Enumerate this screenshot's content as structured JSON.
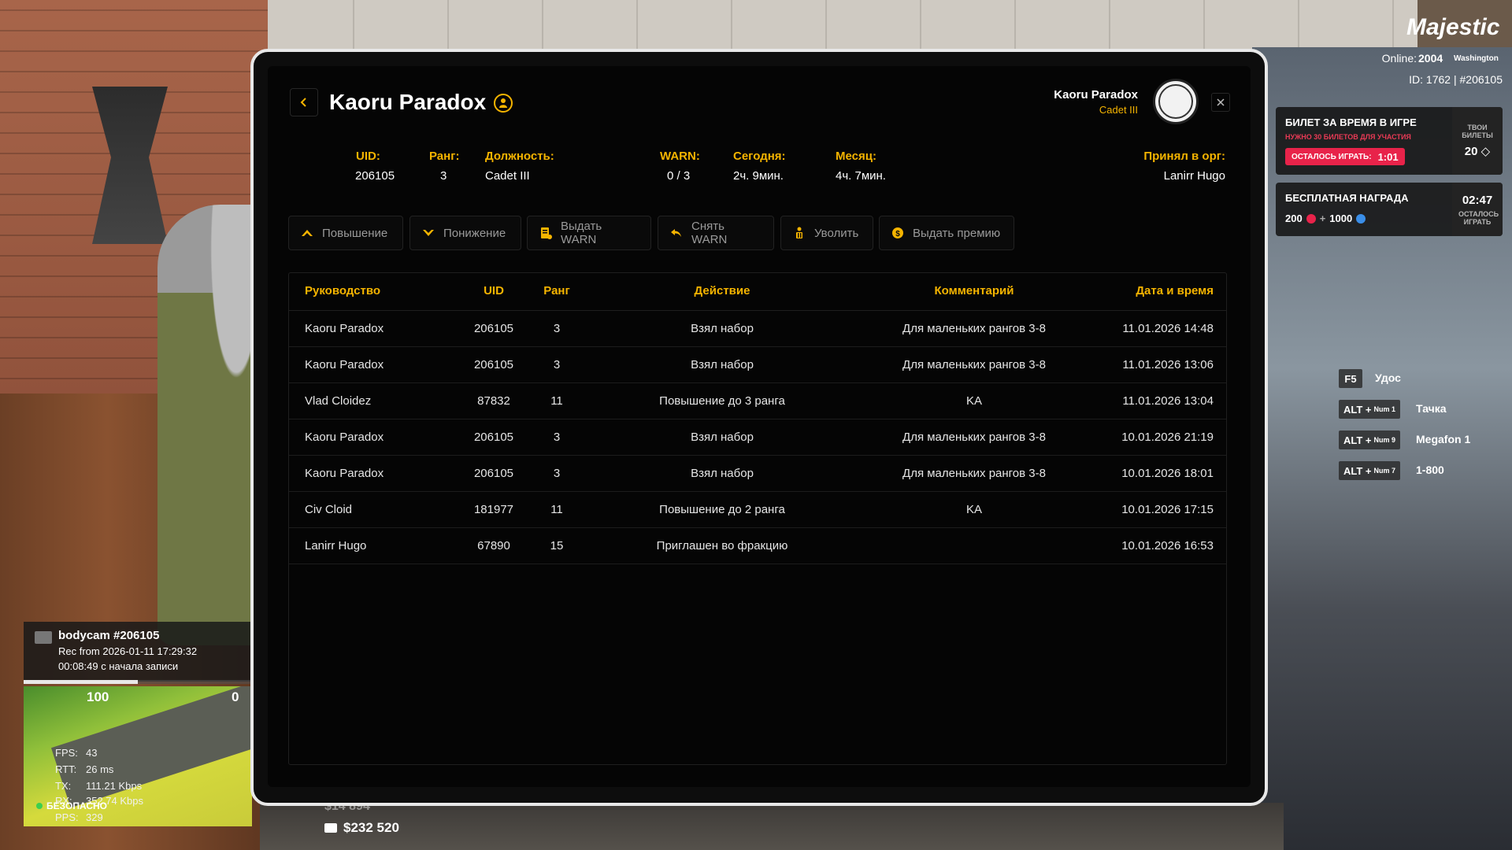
{
  "hud": {
    "brand": "Majestic",
    "online_label": "Online:",
    "online_value": "2004",
    "server": "Washington",
    "ids": "ID: 1762 | #206105"
  },
  "cards": {
    "ticket": {
      "title": "БИЛЕТ ЗА ВРЕМЯ В ИГРЕ",
      "subtitle": "НУЖНО 30 БИЛЕТОВ ДЛЯ УЧАСТИЯ",
      "pill_label": "ОСТАЛОСЬ ИГРАТЬ:",
      "pill_time": "1:01",
      "side_label": "ТВОИ БИЛЕТЫ",
      "side_value": "20"
    },
    "reward": {
      "title": "БЕСПЛАТНАЯ НАГРАДА",
      "value_a": "200",
      "plus": "+",
      "value_b": "1000",
      "side_time": "02:47",
      "side_label": "ОСТАЛОСЬ ИГРАТЬ"
    }
  },
  "hotkeys": [
    {
      "key": "F5",
      "mod": "",
      "label": "Удос"
    },
    {
      "key": "ALT +",
      "mod": "Num 1",
      "label": "Тачка"
    },
    {
      "key": "ALT +",
      "mod": "Num 9",
      "label": "Megafon 1"
    },
    {
      "key": "ALT +",
      "mod": "Num 7",
      "label": "1-800"
    }
  ],
  "panel": {
    "title": "Kaoru Paradox",
    "user_name": "Kaoru Paradox",
    "user_rank": "Cadet III",
    "info": {
      "uid_label": "UID:",
      "uid_value": "206105",
      "rank_label": "Ранг:",
      "rank_value": "3",
      "position_label": "Должность:",
      "position_value": "Cadet III",
      "warn_label": "WARN:",
      "warn_value": "0 / 3",
      "today_label": "Сегодня:",
      "today_value": "2ч. 9мин.",
      "month_label": "Месяц:",
      "month_value": "4ч. 7мин.",
      "hired_label": "Принял в орг:",
      "hired_value": "Lanirr Hugo"
    },
    "actions": {
      "promote": "Повышение",
      "demote": "Понижение",
      "give_warn": "Выдать WARN",
      "remove_warn": "Снять WARN",
      "fire": "Уволить",
      "bonus": "Выдать премию"
    },
    "table": {
      "headers": {
        "manager": "Руководство",
        "uid": "UID",
        "rank": "Ранг",
        "action": "Действие",
        "comment": "Комментарий",
        "datetime": "Дата и время"
      },
      "rows": [
        {
          "name": "Kaoru Paradox",
          "uid": "206105",
          "rank": "3",
          "action": "Взял набор",
          "comment": "Для маленьких рангов 3-8",
          "date": "11.01.2026 14:48"
        },
        {
          "name": "Kaoru Paradox",
          "uid": "206105",
          "rank": "3",
          "action": "Взял набор",
          "comment": "Для маленьких рангов 3-8",
          "date": "11.01.2026 13:06"
        },
        {
          "name": "Vlad Cloidez",
          "uid": "87832",
          "rank": "11",
          "action": "Повышение до 3 ранга",
          "comment": "KA",
          "date": "11.01.2026 13:04"
        },
        {
          "name": "Kaoru Paradox",
          "uid": "206105",
          "rank": "3",
          "action": "Взял набор",
          "comment": "Для маленьких рангов 3-8",
          "date": "10.01.2026 21:19"
        },
        {
          "name": "Kaoru Paradox",
          "uid": "206105",
          "rank": "3",
          "action": "Взял набор",
          "comment": "Для маленьких рангов 3-8",
          "date": "10.01.2026 18:01"
        },
        {
          "name": "Civ Cloid",
          "uid": "181977",
          "rank": "11",
          "action": "Повышение до 2 ранга",
          "comment": "KA",
          "date": "10.01.2026 17:15"
        },
        {
          "name": "Lanirr Hugo",
          "uid": "67890",
          "rank": "15",
          "action": "Приглашен во фракцию",
          "comment": "",
          "date": "10.01.2026 16:53"
        }
      ]
    }
  },
  "bodycam": {
    "title": "bodycam #206105",
    "rec": "Rec from 2026-01-11 17:29:32",
    "elapsed": "00:08:49 с начала записи",
    "progress": 0.5
  },
  "status": {
    "health": "100",
    "armor": "0",
    "fps_label": "FPS:",
    "fps": "43",
    "rtt_label": "RTT:",
    "rtt": "26 ms",
    "tx_label": "TX:",
    "tx": "111.21 Kbps",
    "rx_label": "RX:",
    "rx": "352.74 Kbps",
    "pps_label": "PPS:",
    "pps": "329",
    "safe": "БЕЗОПАСНО",
    "cash_dim": "$14 894",
    "bank": "$232 520"
  },
  "colors": {
    "accent": "#f5b400",
    "pill": "#e8234a",
    "panel_bg": "#050505"
  }
}
